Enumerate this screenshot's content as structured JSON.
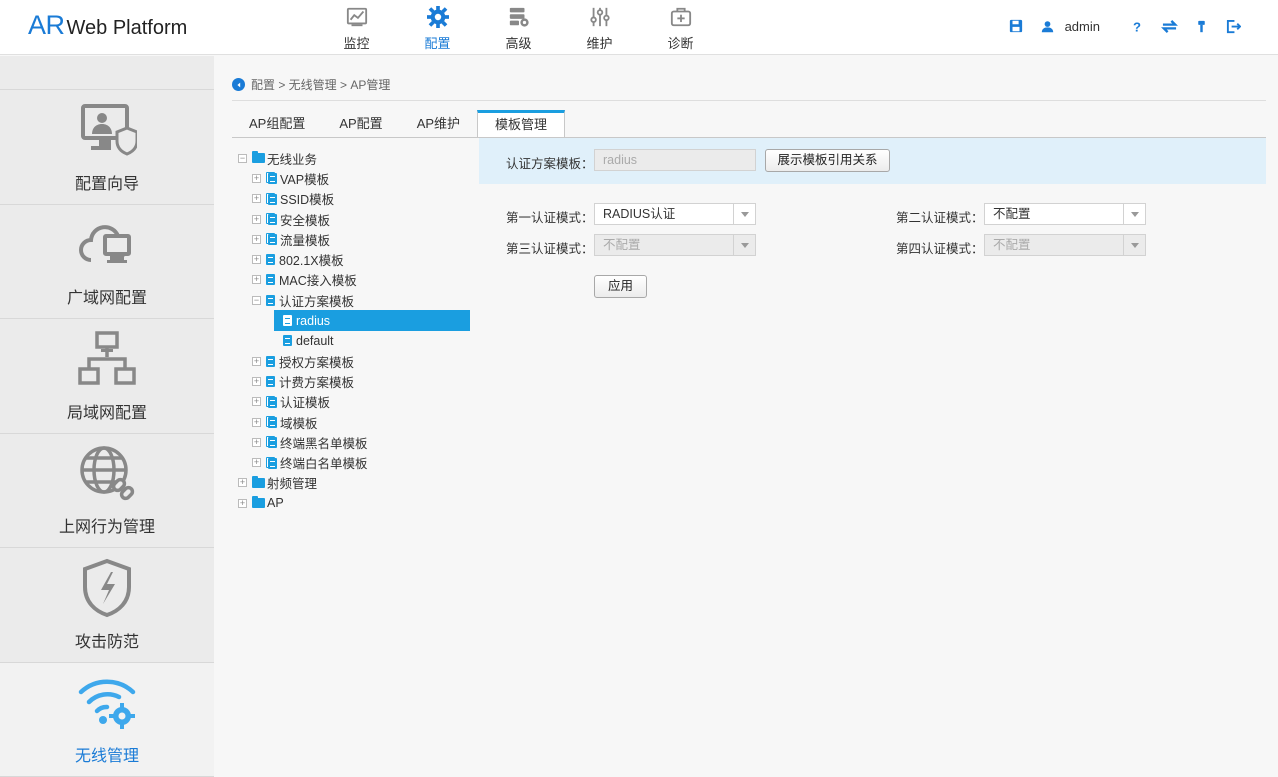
{
  "header": {
    "logo_ar": "AR",
    "logo_rest": "Web Platform",
    "nav": [
      {
        "label": "监控",
        "icon": "monitor-chart-icon"
      },
      {
        "label": "配置",
        "icon": "gear-icon",
        "active": true
      },
      {
        "label": "高级",
        "icon": "database-gear-icon"
      },
      {
        "label": "维护",
        "icon": "sliders-icon"
      },
      {
        "label": "诊断",
        "icon": "medical-kit-icon"
      }
    ],
    "user": "admin",
    "accent": "#1a7bd6"
  },
  "sidebar": {
    "items": [
      {
        "label": "配置向导",
        "icon": "config-wizard-icon"
      },
      {
        "label": "广域网配置",
        "icon": "cloud-computer-icon"
      },
      {
        "label": "局域网配置",
        "icon": "network-topology-icon"
      },
      {
        "label": "上网行为管理",
        "icon": "globe-link-icon"
      },
      {
        "label": "攻击防范",
        "icon": "shield-lightning-icon"
      },
      {
        "label": "无线管理",
        "icon": "wifi-gear-icon",
        "active": true
      }
    ]
  },
  "breadcrumb": "配置 > 无线管理 > AP管理",
  "tabs": [
    {
      "label": "AP组配置"
    },
    {
      "label": "AP配置"
    },
    {
      "label": "AP维护"
    },
    {
      "label": "模板管理",
      "active": true
    }
  ],
  "tree": {
    "root": "无线业务",
    "children": [
      "VAP模板",
      "SSID模板",
      "安全模板",
      "流量模板",
      "802.1X模板",
      "MAC接入模板"
    ],
    "expanded": "认证方案模板",
    "expanded_children": [
      "radius",
      "default"
    ],
    "children_after": [
      "授权方案模板",
      "计费方案模板",
      "认证模板",
      "域模板",
      "终端黑名单模板",
      "终端白名单模板"
    ],
    "others": [
      "射频管理",
      "AP"
    ]
  },
  "form": {
    "auth_scheme_label": "认证方案模板：",
    "auth_scheme_value": "radius",
    "show_ref_button": "展示模板引用关系",
    "mode1_label": "第一认证模式：",
    "mode1_value": "RADIUS认证",
    "mode2_label": "第二认证模式：",
    "mode2_value": "不配置",
    "mode3_label": "第三认证模式：",
    "mode3_value": "不配置",
    "mode4_label": "第四认证模式：",
    "mode4_value": "不配置",
    "apply_button": "应用"
  }
}
